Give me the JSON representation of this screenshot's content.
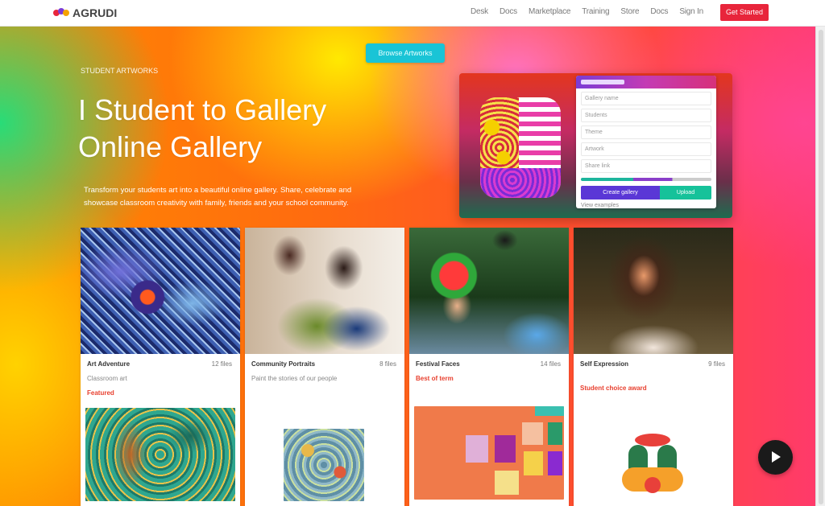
{
  "header": {
    "logo_text": "AGRUDI",
    "nav": [
      "Desk",
      "Docs",
      "Marketplace",
      "Training",
      "Store",
      "Docs",
      "Sign In"
    ],
    "cta_label": "Get Started"
  },
  "hero": {
    "pill_label": "Browse Artworks",
    "eyebrow": "STUDENT ARTWORKS",
    "title_line1": "I Student to Gallery",
    "title_line2": "Online Gallery",
    "description": "Transform your students art into a beautiful online gallery. Share, celebrate and showcase classroom creativity with family, friends and your school community."
  },
  "preview": {
    "rows": [
      "Gallery name",
      "Students",
      "Theme",
      "Artwork",
      "Share link"
    ],
    "primary_btn": "Create gallery",
    "secondary_btn": "Upload",
    "footer": "View examples"
  },
  "cards": [
    {
      "name": "Art Adventure",
      "count": "12 files",
      "sub": "Classroom art",
      "tag": "Featured"
    },
    {
      "name": "Community Portraits",
      "count": "8 files",
      "sub": "Paint the stories of our people",
      "tag": ""
    },
    {
      "name": "Festival Faces",
      "count": "14 files",
      "sub": "",
      "tag": "Best of term"
    },
    {
      "name": "Self Expression",
      "count": "9 files",
      "sub": "",
      "tag": "Student choice award"
    }
  ],
  "colors": {
    "accent_red": "#e8253b",
    "pill_cyan": "#19c4d6",
    "tag_red": "#e8402f"
  },
  "icons": {
    "play": "play-icon"
  }
}
